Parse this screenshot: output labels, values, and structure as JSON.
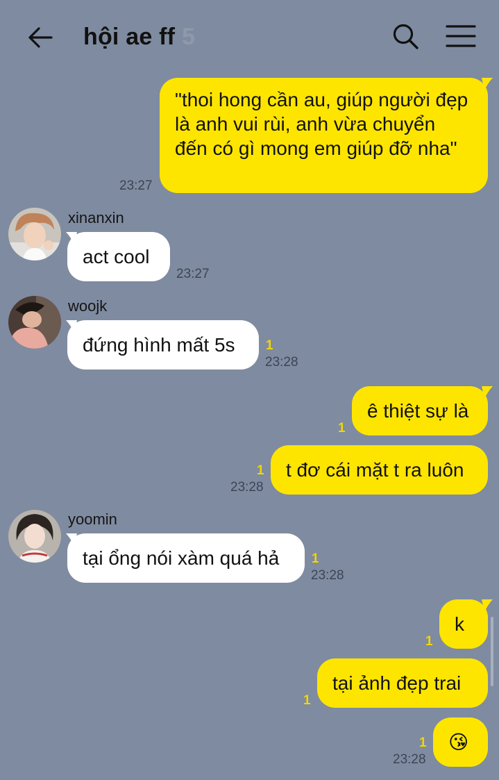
{
  "header": {
    "title": "hội ae ff",
    "member_count": "5",
    "back_icon": "arrow-left-icon",
    "search_icon": "search-icon",
    "menu_icon": "hamburger-menu-icon"
  },
  "colors": {
    "background": "#7f8ba0",
    "my_bubble": "#fee500",
    "other_bubble": "#ffffff",
    "unread": "#f2d600"
  },
  "messages": [
    {
      "from": "me",
      "text": "\"thoi hong cần au, giúp người đẹp là anh vui rùi, anh vừa chuyển đến có gì mong em giúp đỡ nha\"",
      "time": "23:27"
    },
    {
      "from": "xinanxin",
      "text": "act cool",
      "time": "23:27"
    },
    {
      "from": "woojk",
      "text": "đứng hình mất 5s",
      "unread": "1",
      "time": "23:28"
    },
    {
      "from": "me",
      "text": "ê thiệt sự là",
      "unread": "1"
    },
    {
      "from": "me",
      "text": "t đơ cái mặt t ra luôn",
      "unread": "1",
      "time": "23:28"
    },
    {
      "from": "yoomin",
      "text": "tại ổng nói xàm quá hả",
      "unread": "1",
      "time": "23:28"
    },
    {
      "from": "me",
      "text": "k",
      "unread": "1"
    },
    {
      "from": "me",
      "text": "tại ảnh đẹp trai",
      "unread": "1"
    },
    {
      "from": "me",
      "text": "😘",
      "unread": "1",
      "time": "23:28"
    }
  ]
}
